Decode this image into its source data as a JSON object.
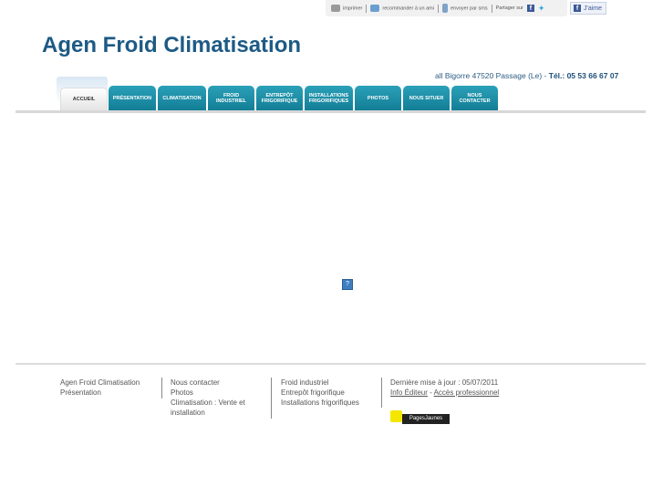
{
  "toolbar": {
    "print": "imprimer",
    "recommend": "recommander à un ami",
    "send": "envoyer par sms",
    "share": "Partager sur",
    "like": "J'aime"
  },
  "header": {
    "title": "Agen Froid Climatisation",
    "address": "all Bigorre 47520 Passage (Le)  - ",
    "phone": "Tél.: 05 53 66 67 07"
  },
  "nav": [
    [
      "ACCUEIL"
    ],
    [
      "PRÉSENTATION"
    ],
    [
      "CLIMATISATION"
    ],
    [
      "FROID",
      "INDUSTRIEL"
    ],
    [
      "ENTREPÔT",
      "FRIGORIFIQUE"
    ],
    [
      "INSTALLATIONS",
      "FRIGORIFIQUES"
    ],
    [
      "PHOTOS"
    ],
    [
      "NOUS SITUER"
    ],
    [
      "NOUS",
      "CONTACTER"
    ]
  ],
  "placeholder_icon": "?",
  "footer": {
    "col1": [
      "Agen Froid Climatisation",
      "Présentation"
    ],
    "col2": [
      "Nous contacter",
      "Photos",
      "Climatisation : Vente et installation"
    ],
    "col3": [
      "Froid industriel",
      "Entrepôt frigorifique",
      "Installations frigorifiques"
    ],
    "update": "Dernière mise à jour : 05/07/2011",
    "info": "Info Éditeur",
    "dash": " - ",
    "pro": "Accès professionnel",
    "pj": "PagesJaunes"
  }
}
